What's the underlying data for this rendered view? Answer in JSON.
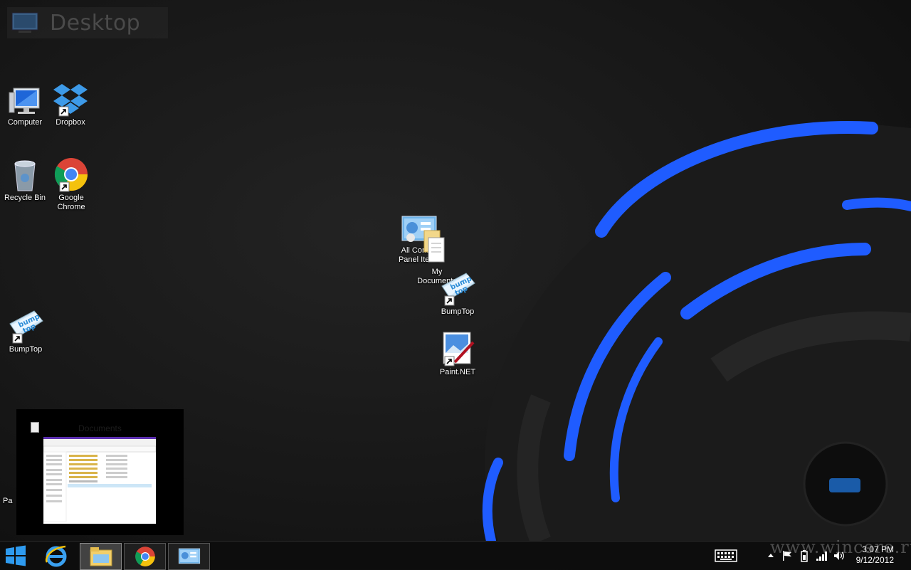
{
  "desktop_header": {
    "title": "Desktop"
  },
  "icons": {
    "computer": "Computer",
    "dropbox": "Dropbox",
    "recycle_bin": "Recycle Bin",
    "google_chrome_1": "Google",
    "google_chrome_2": "Chrome",
    "bumptop_left": "BumpTop",
    "control_panel_1": "All Control",
    "control_panel_2": "Panel Items",
    "my_documents_1": "My",
    "my_documents_2": "Documents",
    "bumptop_center": "BumpTop",
    "paint_net": "Paint.NET",
    "partial_icon": "Pa"
  },
  "taskbar_thumbnail": {
    "title": "Documents"
  },
  "taskbar": {
    "apps": [
      "start-icon",
      "internet-explorer-icon",
      "file-explorer-icon",
      "chrome-icon",
      "control-panel-icon"
    ],
    "clock_time": "3:07 PM",
    "clock_date": "9/12/2012"
  },
  "watermark": "www.wincore.ru",
  "colors": {
    "accent_blue": "#1f5cff",
    "taskbar_bg": "#0e0e0e"
  }
}
